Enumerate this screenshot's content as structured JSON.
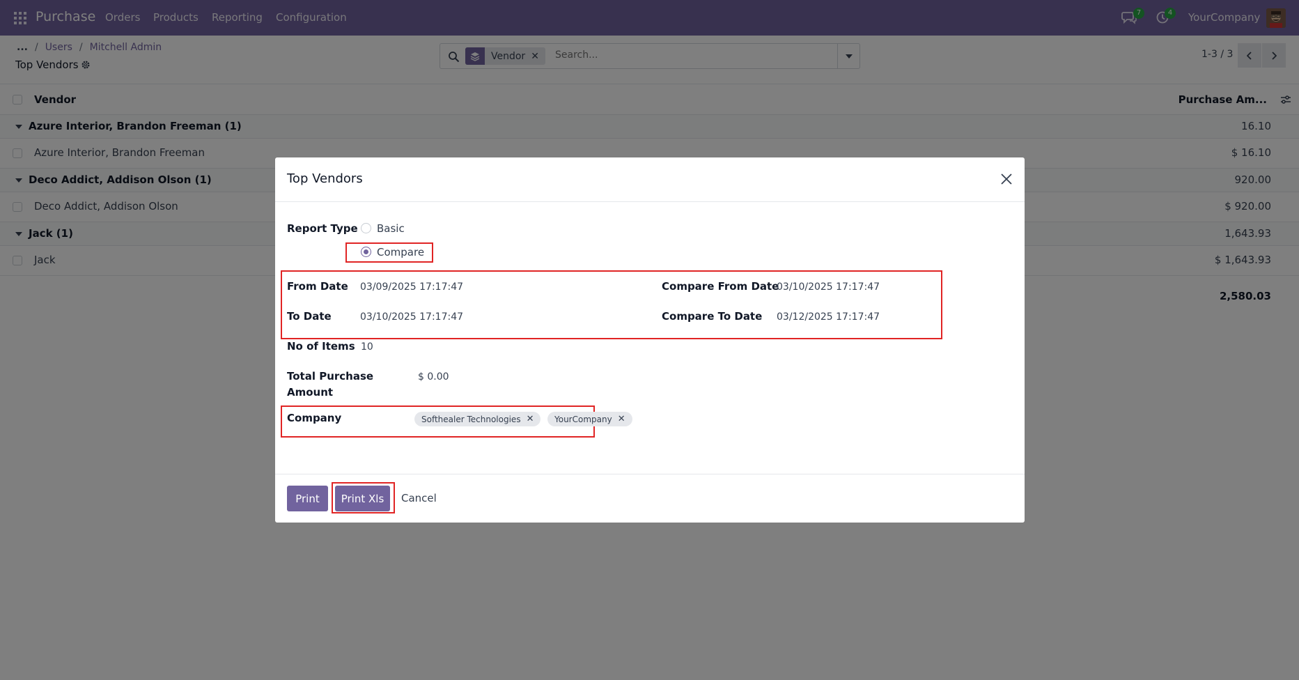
{
  "navbar": {
    "app_name": "Purchase",
    "menu": [
      "Orders",
      "Products",
      "Reporting",
      "Configuration"
    ],
    "messages_count": "7",
    "activities_count": "4",
    "company": "YourCompany",
    "color": "#71639e"
  },
  "control": {
    "breadcrumb": {
      "dots": "...",
      "items": [
        "Users",
        "Mitchell Admin"
      ]
    },
    "title": "Top Vendors",
    "search": {
      "facet": "Vendor",
      "placeholder": "Search..."
    },
    "pager": "1-3 / 3"
  },
  "list": {
    "columns": {
      "vendor": "Vendor",
      "amount": "Purchase Am..."
    },
    "groups": [
      {
        "label": "Azure Interior, Brandon Freeman (1)",
        "amount": "16.10",
        "record": "Azure Interior, Brandon Freeman",
        "record_amount": "$ 16.10"
      },
      {
        "label": "Deco Addict, Addison Olson (1)",
        "amount": "920.00",
        "record": "Deco Addict, Addison Olson",
        "record_amount": "$ 920.00"
      },
      {
        "label": "Jack (1)",
        "amount": "1,643.93",
        "record": "Jack",
        "record_amount": "$ 1,643.93"
      }
    ],
    "total": "2,580.03"
  },
  "dialog": {
    "title": "Top Vendors",
    "report_type_label": "Report Type",
    "options": [
      "Basic",
      "Compare"
    ],
    "selected_option": "Compare",
    "from_date_label": "From Date",
    "from_date": "03/09/2025 17:17:47",
    "to_date_label": "To Date",
    "to_date": "03/10/2025 17:17:47",
    "compare_from_label": "Compare From Date",
    "compare_from": "03/10/2025 17:17:47",
    "compare_to_label": "Compare To Date",
    "compare_to": "03/12/2025 17:17:47",
    "items_label": "No of Items",
    "items": "10",
    "total_label_1": "Total Purchase",
    "total_label_2": "Amount",
    "total_value": "$ 0.00",
    "company_label": "Company",
    "companies": [
      "Softhealer Technologies",
      "YourCompany"
    ],
    "buttons": {
      "print": "Print",
      "print_xls": "Print Xls",
      "cancel": "Cancel"
    },
    "highlight_color": "#e02424"
  }
}
